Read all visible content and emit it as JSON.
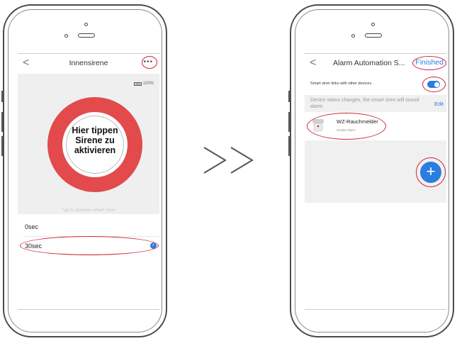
{
  "left": {
    "title": "Innensirene",
    "more_icon": "•••",
    "battery": "100%",
    "siren_text": [
      "Hier tippen",
      "Sirene zu",
      "aktivieren"
    ],
    "tap_label": "Tap to activate smart siren",
    "options": [
      "0sec",
      "30sec"
    ],
    "selected_option": "30sec"
  },
  "separator": ">>",
  "right": {
    "title": "Alarm Automation S...",
    "finished": "Finished",
    "toggle_label": "Smart siren links with other devices",
    "toggle_on": true,
    "status_text": "Device status changes, the smart siren will sound alarm",
    "edit": "Edit",
    "device_name": "WZ-Rauchmelder",
    "device_sub": "Smoke Alarm",
    "fab_icon": "+"
  }
}
